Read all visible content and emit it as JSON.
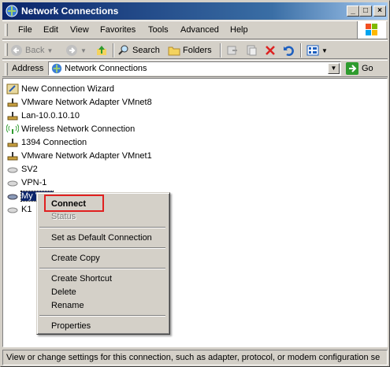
{
  "window": {
    "title": "Network Connections"
  },
  "menubar": {
    "items": [
      "File",
      "Edit",
      "View",
      "Favorites",
      "Tools",
      "Advanced",
      "Help"
    ]
  },
  "toolbar": {
    "back_label": "Back",
    "search_label": "Search",
    "folders_label": "Folders"
  },
  "address": {
    "label": "Address",
    "value": "Network Connections",
    "go_label": "Go"
  },
  "connections": [
    {
      "name": "New Connection Wizard",
      "icon": "wizard-icon"
    },
    {
      "name": "VMware Network Adapter VMnet8",
      "icon": "lan-icon"
    },
    {
      "name": "Lan-10.0.10.10",
      "icon": "lan-icon"
    },
    {
      "name": "Wireless Network Connection",
      "icon": "wireless-icon"
    },
    {
      "name": "1394 Connection",
      "icon": "lan-icon"
    },
    {
      "name": "VMware Network Adapter VMnet1",
      "icon": "lan-icon"
    },
    {
      "name": "SV2",
      "icon": "vpn-icon"
    },
    {
      "name": "VPN-1",
      "icon": "vpn-icon"
    },
    {
      "name": "My VPN",
      "icon": "vpn-icon"
    },
    {
      "name": "K1",
      "icon": "vpn-icon"
    }
  ],
  "context_menu": {
    "connect": "Connect",
    "status": "Status",
    "set_default": "Set as Default Connection",
    "create_copy": "Create Copy",
    "create_shortcut": "Create Shortcut",
    "delete": "Delete",
    "rename": "Rename",
    "properties": "Properties"
  },
  "statusbar": {
    "text": "View or change settings for this connection, such as adapter, protocol, or modem configuration se"
  },
  "colors": {
    "titlebar": "#0a246a",
    "selection": "#0a246a",
    "highlight_box": "#e02020",
    "chrome": "#d4d0c8"
  }
}
